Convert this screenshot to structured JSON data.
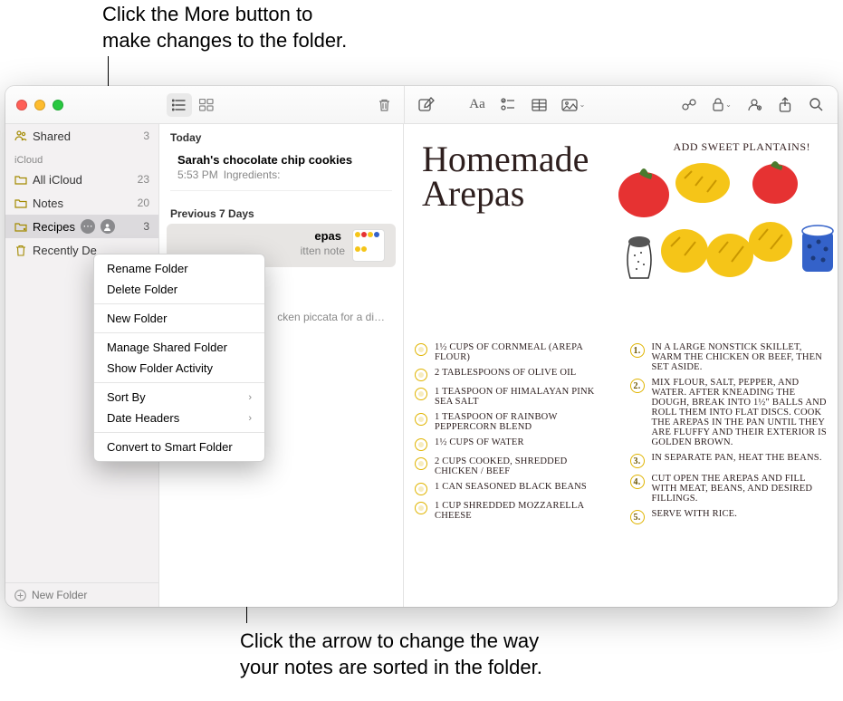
{
  "callouts": {
    "top": "Click the More button to\nmake changes to the folder.",
    "bottom": "Click the arrow to change the way\nyour notes are sorted in the folder."
  },
  "sidebar": {
    "shared": {
      "label": "Shared",
      "count": "3"
    },
    "account_header": "iCloud",
    "items": [
      {
        "label": "All iCloud",
        "count": "23"
      },
      {
        "label": "Notes",
        "count": "20"
      },
      {
        "label": "Recipes",
        "count": "3",
        "selected": true
      },
      {
        "label": "Recently De"
      }
    ],
    "new_folder": "New Folder"
  },
  "notelist": {
    "sections": [
      {
        "header": "Today",
        "items": [
          {
            "title": "Sarah's chocolate chip cookies",
            "time": "5:53 PM",
            "preview": "Ingredients:"
          }
        ]
      },
      {
        "header": "Previous 7 Days",
        "items": [
          {
            "title_suffix": "epas",
            "preview_suffix": "itten note",
            "selected": true,
            "thumb": true
          },
          {
            "preview_full": "cken piccata for a di…"
          }
        ]
      }
    ]
  },
  "note": {
    "title_l1": "Homemade",
    "title_l2": "Arepas",
    "annotation": "ADD SWEET PLANTAINS!",
    "ingredients": [
      "1½ CUPS OF CORNMEAL (AREPA FLOUR)",
      "2 TABLESPOONS OF OLIVE OIL",
      "1 TEASPOON OF HIMALAYAN PINK SEA SALT",
      "1 TEASPOON OF RAINBOW PEPPERCORN BLEND",
      "1½ CUPS OF WATER",
      "2 CUPS COOKED, SHREDDED CHICKEN / BEEF",
      "1 CAN SEASONED BLACK BEANS",
      "1 CUP SHREDDED MOZZARELLA CHEESE"
    ],
    "steps": [
      "IN A LARGE NONSTICK SKILLET, WARM THE CHICKEN OR BEEF, THEN SET ASIDE.",
      "MIX FLOUR, SALT, PEPPER, AND WATER. AFTER KNEADING THE DOUGH, BREAK INTO 1½\" BALLS AND ROLL THEM INTO FLAT DISCS. COOK THE AREPAS IN THE PAN UNTIL THEY ARE FLUFFY AND THEIR EXTERIOR IS GOLDEN BROWN.",
      "IN SEPARATE PAN, HEAT THE BEANS.",
      "CUT OPEN THE AREPAS AND FILL WITH MEAT, BEANS, AND DESIRED FILLINGS.",
      "SERVE WITH RICE."
    ]
  },
  "context_menu": {
    "rename": "Rename Folder",
    "delete": "Delete Folder",
    "new": "New Folder",
    "manage": "Manage Shared Folder",
    "activity": "Show Folder Activity",
    "sort": "Sort By",
    "date": "Date Headers",
    "convert": "Convert to Smart Folder"
  }
}
